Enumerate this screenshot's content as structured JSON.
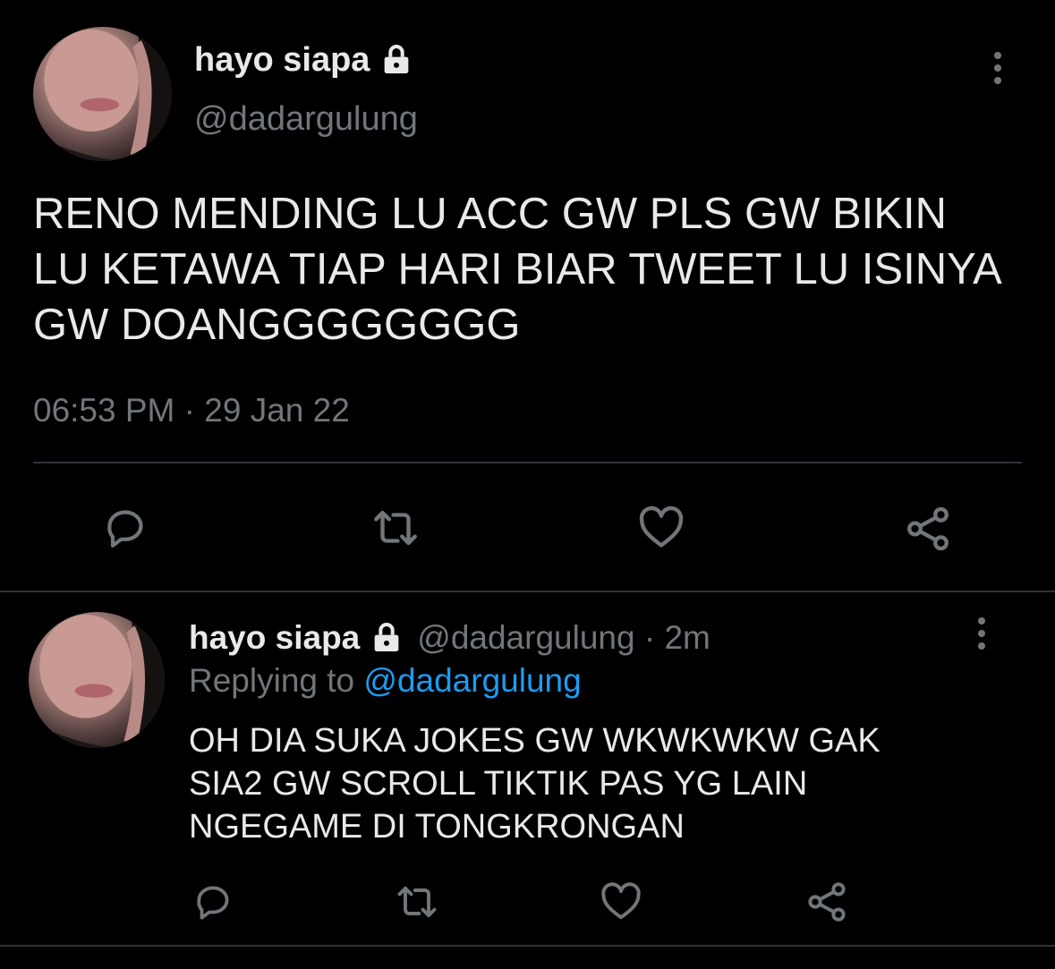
{
  "main_tweet": {
    "display_name": "hayo siapa",
    "handle": "@dadargulung",
    "text": "RENO MENDING LU ACC GW PLS GW BIKIN LU KETAWA TIAP HARI BIAR TWEET LU ISINYA GW DOANGGGGGGGG",
    "time": "06:53 PM",
    "separator": " · ",
    "date": "29 Jan 22",
    "actions": [
      "reply-icon",
      "retweet-icon",
      "like-icon",
      "share-icon"
    ]
  },
  "reply_tweet": {
    "display_name": "hayo siapa",
    "handle": "@dadargulung",
    "time_sep": " · ",
    "time": "2m",
    "replying_prefix": "Replying to ",
    "replying_to": "@dadargulung",
    "text": "OH DIA SUKA JOKES GW WKWKWKW GAK SIA2 GW SCROLL TIKTIK PAS YG LAIN NGEGAME DI TONGKRONGAN",
    "actions": [
      "reply-icon",
      "retweet-icon",
      "like-icon",
      "share-icon"
    ]
  },
  "colors": {
    "background": "#000000",
    "text": "#e7e9ea",
    "muted": "#71767b",
    "link": "#1d9bf0",
    "divider": "#2f3336"
  }
}
